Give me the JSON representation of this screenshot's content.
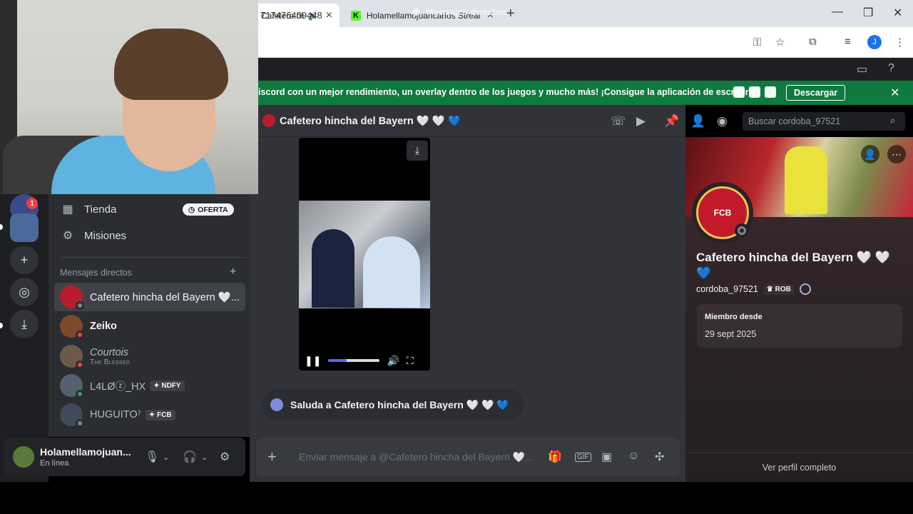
{
  "browser": {
    "tabs": [
      {
        "title": "Cafetero hin",
        "icon": "speaker-icon",
        "active": true
      },
      {
        "title": "Holamellamojuancarlos Stream",
        "icon": "kick-favicon",
        "active": false
      }
    ],
    "url": "717476409448",
    "profile_initial": "J"
  },
  "discord": {
    "top_title": "Mensajes directos",
    "banner": {
      "text": "iscord con un mejor rendimiento, un overlay dentro de los juegos y mucho más! ¡Consigue la aplicación de escritorio!",
      "button": "Descargar"
    },
    "rail": {
      "badge_count": "1"
    },
    "sidebar": {
      "shop_label": "Tienda",
      "offer_label": "OFERTA",
      "missions_label": "Misiones",
      "dm_header": "Mensajes directos",
      "dms": [
        {
          "name": "Cafetero hincha del Bayern 🤍...",
          "sub": "",
          "tag": "",
          "status": "offline",
          "selected": true
        },
        {
          "name": "Zeiko",
          "sub": "",
          "tag": "",
          "status": "dnd",
          "selected": false
        },
        {
          "name": "Courtois",
          "sub": "The Blessed",
          "tag": "",
          "status": "dnd",
          "selected": false
        },
        {
          "name": "L4LØⓩ_HX",
          "sub": "",
          "tag": "NDFY",
          "status": "online",
          "selected": false
        },
        {
          "name": "HUGUITO⁷",
          "sub": "",
          "tag": "FCB",
          "status": "offline",
          "selected": false
        }
      ]
    },
    "user_panel": {
      "name": "Holamellamojuan...",
      "status": "En línea"
    },
    "chat": {
      "title": "Cafetero hincha del Bayern 🤍 🤍 💙",
      "search_placeholder": "Buscar cordoba_97521",
      "video_progress": 0.35,
      "wave_text": "Saluda a Cafetero hincha del Bayern 🤍 🤍 💙",
      "composer_placeholder": "Enviar mensaje a @Cafetero hincha del Bayern 🤍..."
    },
    "profile": {
      "display_name": "Cafetero hincha del Bayern 🤍 🤍 💙",
      "username": "cordoba_97521",
      "tag": "ROB",
      "member_since_label": "Miembro desde",
      "member_since_value": "29 sept 2025",
      "full_profile_label": "Ver perfil completo"
    }
  }
}
